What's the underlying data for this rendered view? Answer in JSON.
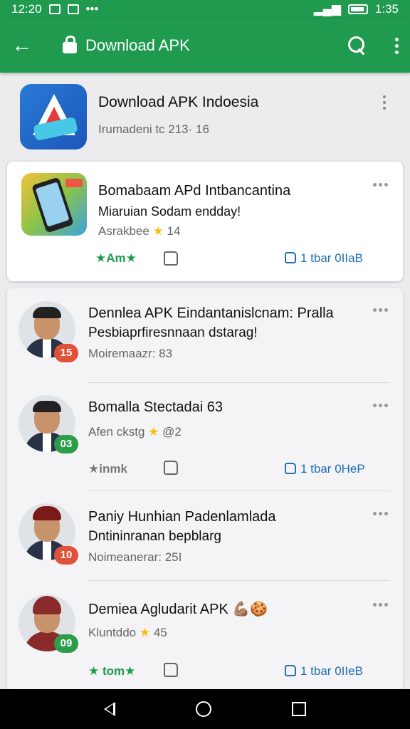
{
  "status_bar": {
    "left_time": "12:20",
    "right_time": "1:35",
    "more": "•••"
  },
  "app_bar": {
    "title": "Download APK",
    "back_icon": "arrow-left-icon",
    "lock_icon": "lock-icon",
    "search_icon": "search-icon",
    "menu_icon": "more-vert-icon"
  },
  "header": {
    "title": "Download APK Indoesia",
    "subtitle": "Irumadeni tc 213· 16"
  },
  "featured": {
    "title": "Bomabaam APd Intbancantina",
    "subtitle": "Miaruian Sodam endday!",
    "meta": "Asrakbee",
    "meta_count": "14",
    "rating_label": "★Am★",
    "like_label": "1 tbar 0IIaB"
  },
  "items": [
    {
      "title": "Dennlea APK Eindantanislcnam: Pralla",
      "subtitle": "Pesbiaprfiresnnaan dstarag!",
      "meta": "Moiremaazr: 83",
      "badge": "15",
      "badge_color": "#e0533a"
    },
    {
      "title": "Bomalla Stectadai 63",
      "meta": "Afen ckstg",
      "meta_count": "@2",
      "badge": "03",
      "badge_color": "#2e9d4a",
      "rating_label": "★inmk",
      "like_label": "1 tbar 0HeP"
    },
    {
      "title": "Paniy Hunhian Padenlamlada",
      "subtitle": "Dntininranan bepblarg",
      "meta": "Noimeanerar: 25I",
      "badge": "10",
      "badge_color": "#e0533a"
    },
    {
      "title": "Demiea Agludarit APK",
      "title_emoji": "💪🏽🍪",
      "meta": "Kluntddo",
      "meta_count": "45",
      "badge": "09",
      "badge_color": "#2e9d4a",
      "rating_label": "★ tom★",
      "like_label": "1 tbar 0IIeB"
    }
  ]
}
